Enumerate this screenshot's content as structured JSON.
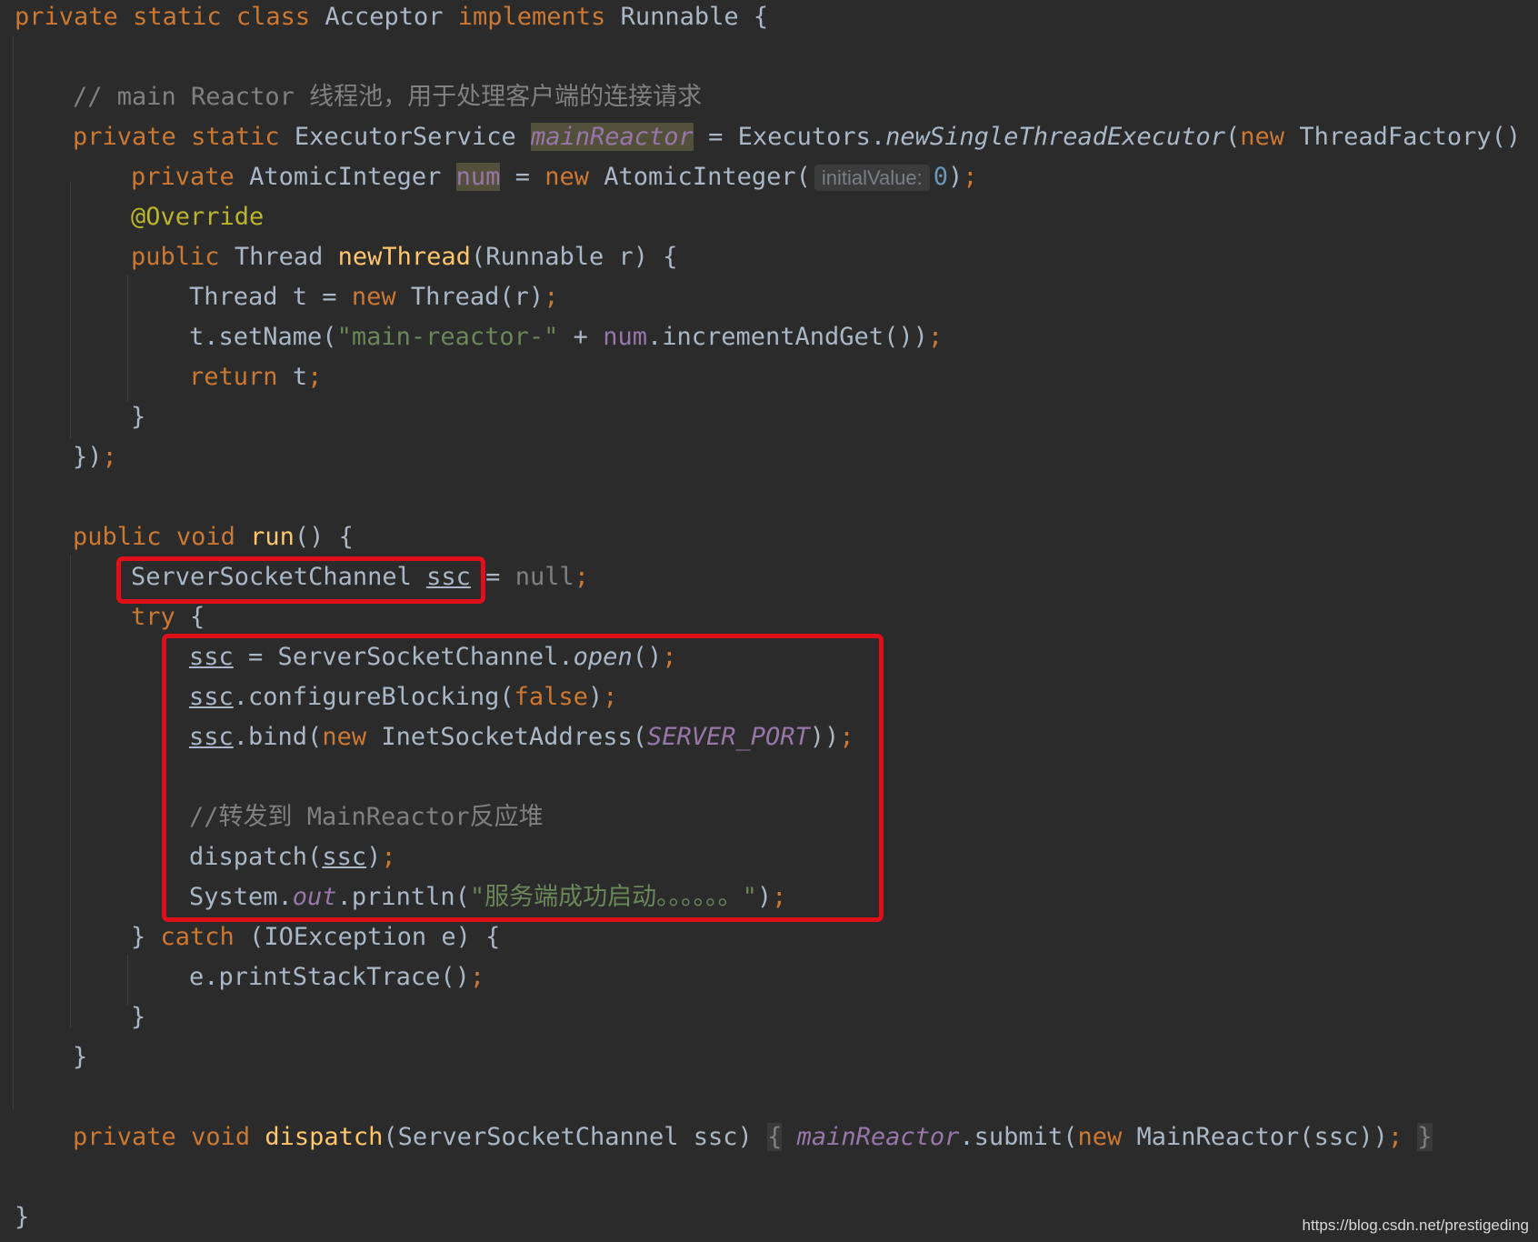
{
  "code": {
    "t1": "private",
    "t2": "static",
    "t3": "class",
    "t4": "Acceptor",
    "t5": "implements",
    "t6": "Runnable",
    "t7": "{",
    "t8": "// main Reactor 线程池，用于处理客户端的连接请求",
    "t9": "private",
    "t10": "static",
    "t11": "ExecutorService",
    "t12": "mainReactor",
    "t13": "= Executors.",
    "t14": "newSingleThreadExecutor",
    "t15": "(",
    "t16": "new",
    "t17": "ThreadFactory() {",
    "t18": "private",
    "t19": "AtomicInteger",
    "t20": "num",
    "t21": "=",
    "t22": "new",
    "t23": "AtomicInteger(",
    "t24": "initialValue:",
    "t25": "0",
    "t26": ")",
    "t27": ";",
    "t28": "@Override",
    "t29": "public",
    "t30": "Thread",
    "t31": "newThread",
    "t32": "(Runnable r) {",
    "t33": "Thread t =",
    "t34": "new",
    "t35": "Thread(r)",
    "t36": ";",
    "t37": "t.setName(",
    "t38": "\"main-reactor-\"",
    "t39": "+",
    "t40": "num",
    "t41": ".incrementAndGet())",
    "t42": ";",
    "t43": "return",
    "t44": "t",
    "t45": ";",
    "t46": "}",
    "t47": "})",
    "t48": ";",
    "t49": "public",
    "t50": "void",
    "t51": "run",
    "t52": "() {",
    "t53": "ServerSocketChannel",
    "t54": "ssc",
    "t55": "= ",
    "t56": "null",
    "t57": ";",
    "t58": "try",
    "t59": "{",
    "t60": "ssc",
    "t61": "= ServerSocketChannel.",
    "t62": "open",
    "t63": "()",
    "t64": ";",
    "t65": "ssc",
    "t66": ".configureBlocking(",
    "t67": "false",
    "t68": ")",
    "t69": ";",
    "t70": "ssc",
    "t71": ".bind(",
    "t72": "new",
    "t73": "InetSocketAddress(",
    "t74": "SERVER_PORT",
    "t75": "))",
    "t76": ";",
    "t77": "//转发到 MainReactor反应堆",
    "t78": "dispatch(",
    "t79": "ssc",
    "t80": ")",
    "t81": ";",
    "t82": "System.",
    "t83": "out",
    "t84": ".println(",
    "t85": "\"服务端成功启动。。。。。。\"",
    "t86": ")",
    "t87": ";",
    "t88": "}",
    "t89": "catch",
    "t90": "(IOException e) {",
    "t91": "e.printStackTrace()",
    "t92": ";",
    "t93": "}",
    "t94": "}",
    "t95": "private",
    "t96": "void",
    "t97": "dispatch",
    "t98": "(ServerSocketChannel ssc)",
    "t99": "{",
    "t100": "mainReactor",
    "t101": ".submit(",
    "t102": "new",
    "t103": "MainReactor(ssc))",
    "t104": ";",
    "t105": "}",
    "t106": "}"
  },
  "watermark": "https://blog.csdn.net/prestigeding",
  "colors": {
    "background": "#2b2b2b",
    "keyword": "#cc7832",
    "comment": "#808080",
    "string": "#6a8759",
    "method": "#ffc66d",
    "annotation": "#bbb529",
    "field": "#9876aa",
    "default_text": "#a9b7c6",
    "highlight_box": "#e0101a"
  }
}
